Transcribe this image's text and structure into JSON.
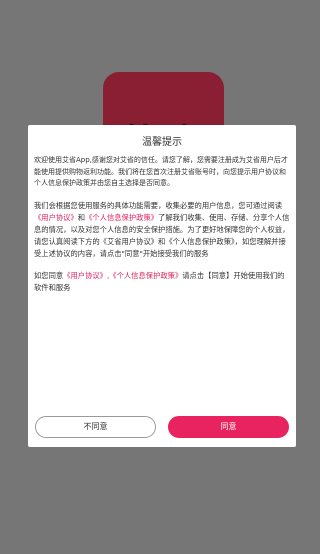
{
  "app": {
    "logo_text": "艾省",
    "logo_color": "#8a1f33"
  },
  "dialog": {
    "title": "温馨提示",
    "p1": "欢迎使用艾省App,感谢您对艾省的信任。请您了解，您需要注册成为艾省用户后才能使用提供购物返利功能。我们将在您首次注册艾省账号时，向您提示用户协议和个人信息保护政策并由您自主选择是否同意。",
    "p2_a": "我们会根据您使用服务的具体功能需要，收集必要的用户信息，您可通过阅读",
    "p2_link1": "《用户协议》",
    "p2_b": "和",
    "p2_link2": "《个人信息保护政策》",
    "p2_c": "了解我们收集、使用、存储、分享个人信息的情况，以及对您个人信息的安全保护措施。为了更好地保障您的个人权益，请您认真阅读下方的《艾省用户协议》和《个人信息保护政策》，如您理解并接受上述协议的内容，请点击\"同意\"开始接受我们的服务",
    "p3_a": "如您同意",
    "p3_link1": "《用户协议》",
    "p3_sep": ",",
    "p3_link2": "《个人信息保护政策》",
    "p3_b": "请点击【同意】开始使用我们的软件和服务",
    "link_color": "#e0225c",
    "disagree_label": "不同意",
    "agree_label": "同意",
    "agree_color": "#e8235f"
  }
}
